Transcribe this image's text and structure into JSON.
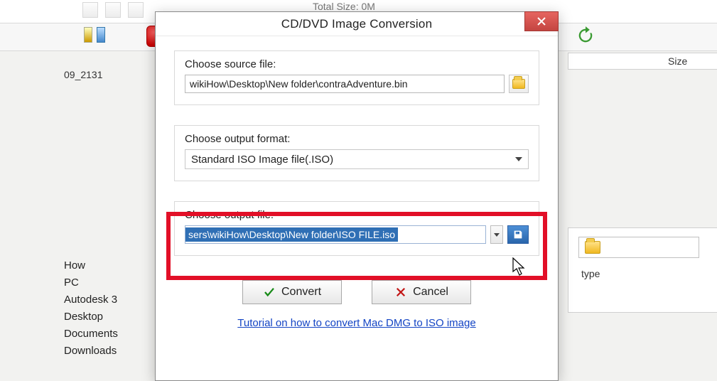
{
  "bg": {
    "total_size": "Total Size: 0M",
    "size_col": "Size",
    "file_label": "09_2131",
    "left_list": [
      "How",
      "PC",
      "Autodesk 3",
      "Desktop",
      "Documents",
      "Downloads"
    ],
    "right_type": "type"
  },
  "dialog": {
    "title": "CD/DVD Image Conversion",
    "source": {
      "label": "Choose source file:",
      "value": "wikiHow\\Desktop\\New folder\\contraAdventure.bin"
    },
    "format": {
      "label": "Choose output format:",
      "value": "Standard ISO Image file(.ISO)"
    },
    "output": {
      "label": "Choose output file:",
      "value": "sers\\wikiHow\\Desktop\\New folder\\ISO FILE.iso"
    },
    "convert": "Convert",
    "cancel": "Cancel",
    "tutorial": "Tutorial on how to convert Mac DMG to ISO image"
  }
}
